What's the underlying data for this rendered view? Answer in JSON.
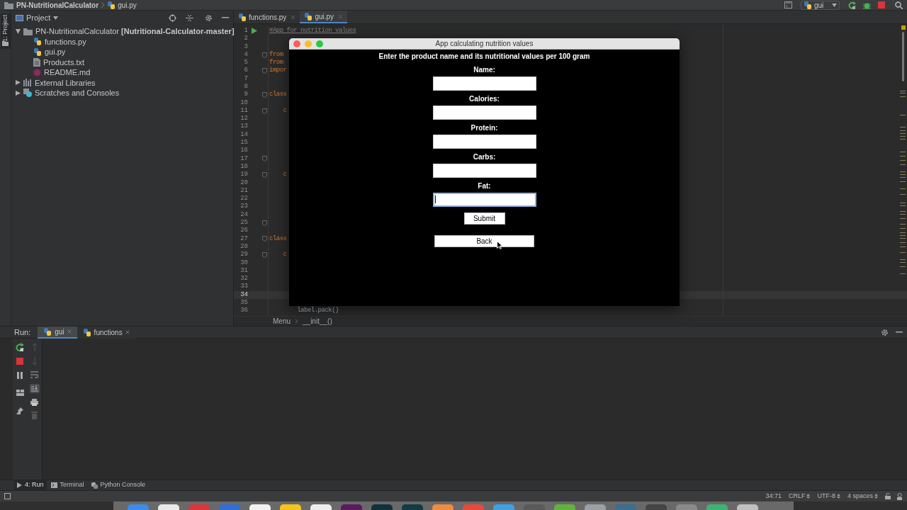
{
  "top_bar": {
    "project": "PN-NutritionalCalculator",
    "file": "gui.py",
    "run_config": "gui"
  },
  "side_tab": "1: Project",
  "project_panel": {
    "title": "Project",
    "tree": [
      {
        "label": "PN-NutritionalCalculator **[Nutritional-Calculator-master]**",
        "kind": "folder",
        "expanded": true,
        "children": [
          {
            "label": "functions.py",
            "kind": "python"
          },
          {
            "label": "gui.py",
            "kind": "python"
          },
          {
            "label": "Products.txt",
            "kind": "text"
          },
          {
            "label": "README.md",
            "kind": "markdown"
          }
        ]
      },
      {
        "label": "External Libraries",
        "kind": "library",
        "expanded": false
      },
      {
        "label": "Scratches and Consoles",
        "kind": "scratches",
        "expanded": false
      }
    ]
  },
  "editor": {
    "tabs": [
      {
        "label": "functions.py",
        "selected": false
      },
      {
        "label": "gui.py",
        "selected": true
      }
    ],
    "lines": [
      {
        "number": "1",
        "current": false,
        "fold": false,
        "text": "#App for nutrition values",
        "kind": "comment"
      },
      {
        "number": "2",
        "current": false,
        "fold": false
      },
      {
        "number": "3",
        "current": false,
        "fold": false
      },
      {
        "number": "4",
        "current": false,
        "fold": true,
        "text": "from",
        "kind": "keyword"
      },
      {
        "number": "5",
        "current": false,
        "fold": false,
        "text": "from",
        "kind": "keyword"
      },
      {
        "number": "6",
        "current": false,
        "fold": true,
        "text": "impor",
        "kind": "keyword"
      },
      {
        "number": "7",
        "current": false,
        "fold": false
      },
      {
        "number": "8",
        "current": false,
        "fold": false
      },
      {
        "number": "9",
        "current": false,
        "fold": true,
        "text": "class",
        "kind": "keyword"
      },
      {
        "number": "10",
        "current": false,
        "fold": false
      },
      {
        "number": "11",
        "current": false,
        "fold": true,
        "text": "    c",
        "kind": "keyword"
      },
      {
        "number": "12",
        "current": false,
        "fold": false
      },
      {
        "number": "13",
        "current": false,
        "fold": false
      },
      {
        "number": "14",
        "current": false,
        "fold": false
      },
      {
        "number": "15",
        "current": false,
        "fold": false
      },
      {
        "number": "16",
        "current": false,
        "fold": false
      },
      {
        "number": "17",
        "current": false,
        "fold": true
      },
      {
        "number": "18",
        "current": false,
        "fold": false
      },
      {
        "number": "19",
        "current": false,
        "fold": true,
        "text": "    c",
        "kind": "keyword"
      },
      {
        "number": "20",
        "current": false,
        "fold": false
      },
      {
        "number": "21",
        "current": false,
        "fold": false
      },
      {
        "number": "22",
        "current": false,
        "fold": false
      },
      {
        "number": "23",
        "current": false,
        "fold": false
      },
      {
        "number": "24",
        "current": false,
        "fold": false
      },
      {
        "number": "25",
        "current": false,
        "fold": true
      },
      {
        "number": "26",
        "current": false,
        "fold": false
      },
      {
        "number": "27",
        "current": false,
        "fold": true,
        "text": "class",
        "kind": "keyword"
      },
      {
        "number": "28",
        "current": false,
        "fold": false
      },
      {
        "number": "29",
        "current": false,
        "fold": true,
        "text": "    c",
        "kind": "keyword"
      },
      {
        "number": "30",
        "current": false,
        "fold": false
      },
      {
        "number": "31",
        "current": false,
        "fold": false
      },
      {
        "number": "32",
        "current": false,
        "fold": false
      },
      {
        "number": "33",
        "current": false,
        "fold": false
      },
      {
        "number": "34",
        "current": true,
        "fold": false
      },
      {
        "number": "35",
        "current": false,
        "fold": false
      },
      {
        "number": "36",
        "current": false,
        "fold": false,
        "text": "        label.pack()",
        "kind": "plain"
      }
    ],
    "breadcrumb": [
      "Menu",
      "__init__()"
    ]
  },
  "app_window": {
    "title": "App calculating nutrition values",
    "heading": "Enter the product name and its nutritional values per 100 gram",
    "fields": [
      {
        "label": "Name:",
        "focused": false
      },
      {
        "label": "Calories:",
        "focused": false
      },
      {
        "label": "Protein:",
        "focused": false
      },
      {
        "label": "Carbs:",
        "focused": false
      },
      {
        "label": "Fat:",
        "focused": true
      }
    ],
    "submit": "Submit",
    "back": "Back"
  },
  "run_panel": {
    "title": "Run:",
    "tabs": [
      {
        "label": "gui",
        "selected": true
      },
      {
        "label": "functions",
        "selected": false
      }
    ]
  },
  "tool_tabs": [
    {
      "label": "4: Run",
      "kind": "run",
      "selected": true
    },
    {
      "label": "Terminal",
      "kind": "terminal",
      "selected": false
    },
    {
      "label": "Python Console",
      "kind": "console",
      "selected": false
    }
  ],
  "status_bar": [
    "34:71",
    "CRLF",
    "UTF-8",
    "4 spaces"
  ]
}
